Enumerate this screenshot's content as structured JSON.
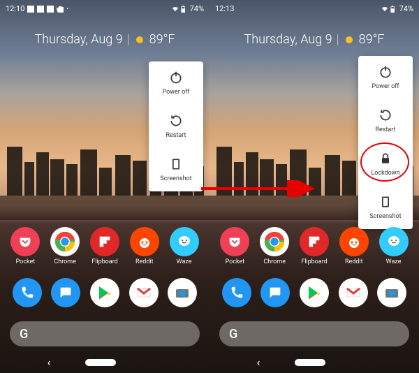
{
  "left": {
    "status": {
      "time": "12:10",
      "battery": "74%"
    },
    "date": "Thursday, Aug 9",
    "temp": "89°F",
    "power": {
      "poweroff": "Power off",
      "restart": "Restart",
      "screenshot": "Screenshot"
    },
    "apps": {
      "pocket": "Pocket",
      "chrome": "Chrome",
      "flipboard": "Flipboard",
      "reddit": "Reddit",
      "waze": "Waze"
    }
  },
  "right": {
    "status": {
      "time": "12:13",
      "battery": "74%"
    },
    "date": "Thursday, Aug 9",
    "temp": "89°F",
    "power": {
      "poweroff": "Power off",
      "restart": "Restart",
      "lockdown": "Lockdown",
      "screenshot": "Screenshot"
    },
    "apps": {
      "pocket": "Pocket",
      "chrome": "Chrome",
      "flipboard": "Flipboard",
      "reddit": "Reddit",
      "waze": "Waze"
    }
  },
  "search": "G"
}
